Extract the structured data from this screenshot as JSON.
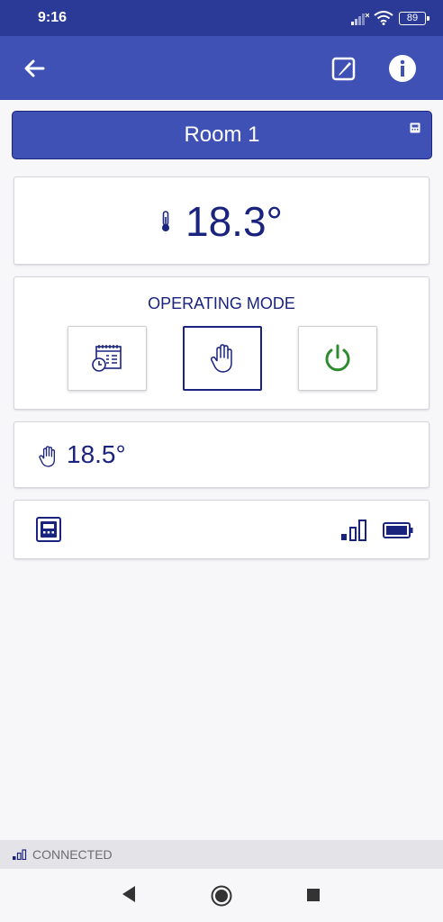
{
  "status_bar": {
    "time": "9:16",
    "battery_level": "89"
  },
  "app_bar": {
    "back_icon": "arrow-left-icon",
    "edit_icon": "edit-square-icon",
    "info_icon": "info-circle-icon"
  },
  "room": {
    "name": "Room 1"
  },
  "current_temperature": {
    "value": "18.3°"
  },
  "operating_mode": {
    "title": "OPERATING MODE",
    "modes": [
      {
        "icon": "schedule-calendar-icon",
        "active": false
      },
      {
        "icon": "hand-manual-icon",
        "active": true
      },
      {
        "icon": "power-icon",
        "active": false
      }
    ]
  },
  "setpoint": {
    "value": "18.5°"
  },
  "device": {
    "signal_icon": "signal-strength-icon",
    "battery_icon": "battery-full-icon"
  },
  "connection": {
    "status": "CONNECTED"
  },
  "colors": {
    "primary": "#3f51b5",
    "primary_dark": "#1a237e",
    "statusbar": "#2a3a96",
    "power_green": "#2e8b2e"
  }
}
